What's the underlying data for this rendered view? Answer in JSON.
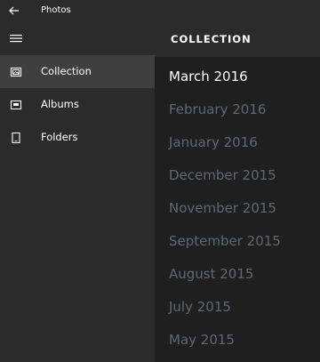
{
  "titlebar": {
    "title": "Photos",
    "back_icon": "back-arrow-icon"
  },
  "sidebar": {
    "menu_icon": "hamburger-icon",
    "items": [
      {
        "label": "Collection",
        "icon": "collection-icon",
        "selected": true
      },
      {
        "label": "Albums",
        "icon": "album-icon",
        "selected": false
      },
      {
        "label": "Folders",
        "icon": "folder-icon",
        "selected": false
      }
    ]
  },
  "main": {
    "header": "COLLECTION",
    "dates": [
      "March 2016",
      "February 2016",
      "January 2016",
      "December 2015",
      "November 2015",
      "September 2015",
      "August 2015",
      "July 2015",
      "May 2015"
    ]
  },
  "colors": {
    "background": "#1f1f1f",
    "panel": "#2b2b2b",
    "selected": "#3f3f3f",
    "muted_text": "#5c6877",
    "text": "#ffffff"
  }
}
